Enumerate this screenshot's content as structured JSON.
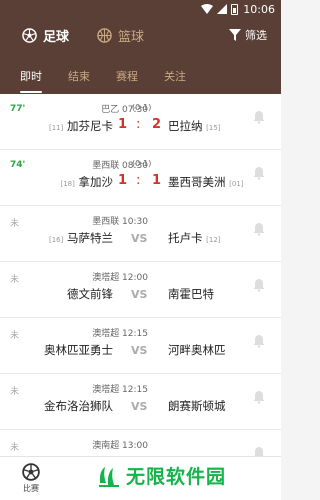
{
  "status": {
    "time": "10:06"
  },
  "sports": [
    {
      "label": "足球"
    },
    {
      "label": "篮球"
    }
  ],
  "filter_label": "筛选",
  "tabs": [
    {
      "label": "即时"
    },
    {
      "label": "结束"
    },
    {
      "label": "赛程"
    },
    {
      "label": "关注"
    }
  ],
  "matches": [
    {
      "minute": "77'",
      "league": "巴乙 07:30",
      "half": "(0-1)",
      "home": "加芬尼卡",
      "home_rank": "[11]",
      "home_score": "1",
      "sep": ":",
      "away_score": "2",
      "away": "巴拉纳",
      "away_rank": "[15]"
    },
    {
      "minute": "74'",
      "league": "墨西联 08:30",
      "half": "(0-1)",
      "home": "拿加沙",
      "home_rank": "[18]",
      "home_score": "1",
      "sep": ":",
      "away_score": "1",
      "away": "墨西哥美洲",
      "away_rank": "[01]"
    },
    {
      "minute": "未",
      "league": "墨西联 10:30",
      "home": "马萨特兰",
      "home_rank": "[16]",
      "vs": "VS",
      "away": "托卢卡",
      "away_rank": "[12]"
    },
    {
      "minute": "未",
      "league": "澳塔超 12:00",
      "home": "德文前锋",
      "vs": "VS",
      "away": "南霍巴特"
    },
    {
      "minute": "未",
      "league": "澳塔超 12:15",
      "home": "奥林匹亚勇士",
      "vs": "VS",
      "away": "河畔奥林匹"
    },
    {
      "minute": "未",
      "league": "澳塔超 12:15",
      "home": "金布洛治狮队",
      "vs": "VS",
      "away": "朗赛斯顿城"
    },
    {
      "minute": "未",
      "league": "澳南超 13:00",
      "home": "",
      "vs": "",
      "away": ""
    }
  ],
  "nav": {
    "label": "比赛"
  },
  "watermark": {
    "text": "无限软件园"
  },
  "colors": {
    "header": "#5a3f36",
    "accent_live": "#27a844",
    "score": "#d9302c",
    "inactive_tab": "#c9aa83",
    "watermark": "#16b34a"
  }
}
